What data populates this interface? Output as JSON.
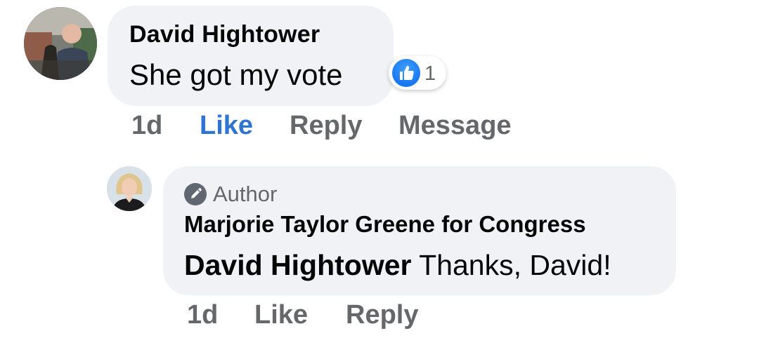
{
  "comment_1": {
    "author": "David Hightower",
    "text": "She got my vote",
    "reaction": {
      "icon": "like-icon",
      "color": "#1877f2",
      "count": "1"
    },
    "actions": {
      "time": "1d",
      "like": "Like",
      "reply": "Reply",
      "message": "Message"
    },
    "like_color": "#2f74d0"
  },
  "reply_1": {
    "badge_icon": "pencil-icon",
    "badge": "Author",
    "author": "Marjorie Taylor Greene for Congress",
    "mention": "David Hightower",
    "text": " Thanks, David!",
    "actions": {
      "time": "1d",
      "like": "Like",
      "reply": "Reply"
    }
  },
  "colors": {
    "bubble": "#f0f2f5",
    "secondary_text": "#65676b",
    "primary_text": "#050505"
  }
}
